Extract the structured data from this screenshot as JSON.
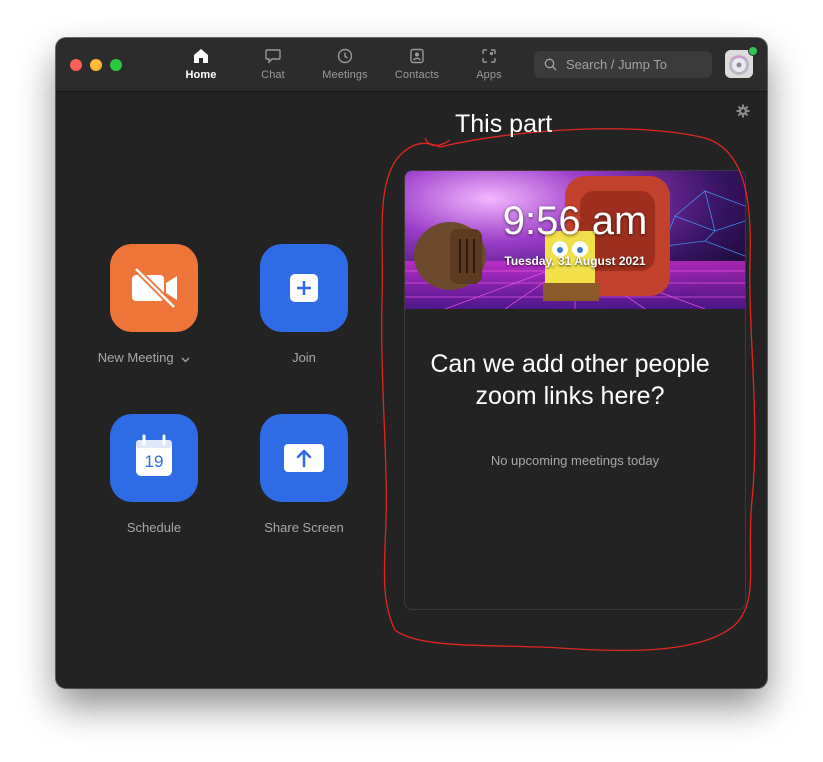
{
  "app": {
    "nav": [
      {
        "label": "Home",
        "icon": "home-icon",
        "active": true
      },
      {
        "label": "Chat",
        "icon": "chat-icon",
        "active": false
      },
      {
        "label": "Meetings",
        "icon": "clock-icon",
        "active": false
      },
      {
        "label": "Contacts",
        "icon": "contacts-icon",
        "active": false
      },
      {
        "label": "Apps",
        "icon": "apps-icon",
        "active": false
      }
    ],
    "search": {
      "placeholder": "Search / Jump To"
    },
    "presence_color": "#2dc653"
  },
  "actions": {
    "new_meeting": {
      "label": "New Meeting",
      "icon": "video-off-icon",
      "color": "#ee7538"
    },
    "join": {
      "label": "Join",
      "icon": "plus-icon",
      "color": "#2e6ce6"
    },
    "schedule": {
      "label": "Schedule",
      "icon": "calendar-icon",
      "day": "19",
      "color": "#2e6ce6"
    },
    "share_screen": {
      "label": "Share Screen",
      "icon": "share-arrow-icon",
      "color": "#2e6ce6"
    }
  },
  "calendar": {
    "time": "9:56 am",
    "date": "Tuesday, 31 August 2021",
    "empty_text": "No upcoming meetings today"
  },
  "annotations": {
    "title": "This part",
    "question": "Can we add other people zoom links here?",
    "stroke_color": "#e0261f"
  }
}
